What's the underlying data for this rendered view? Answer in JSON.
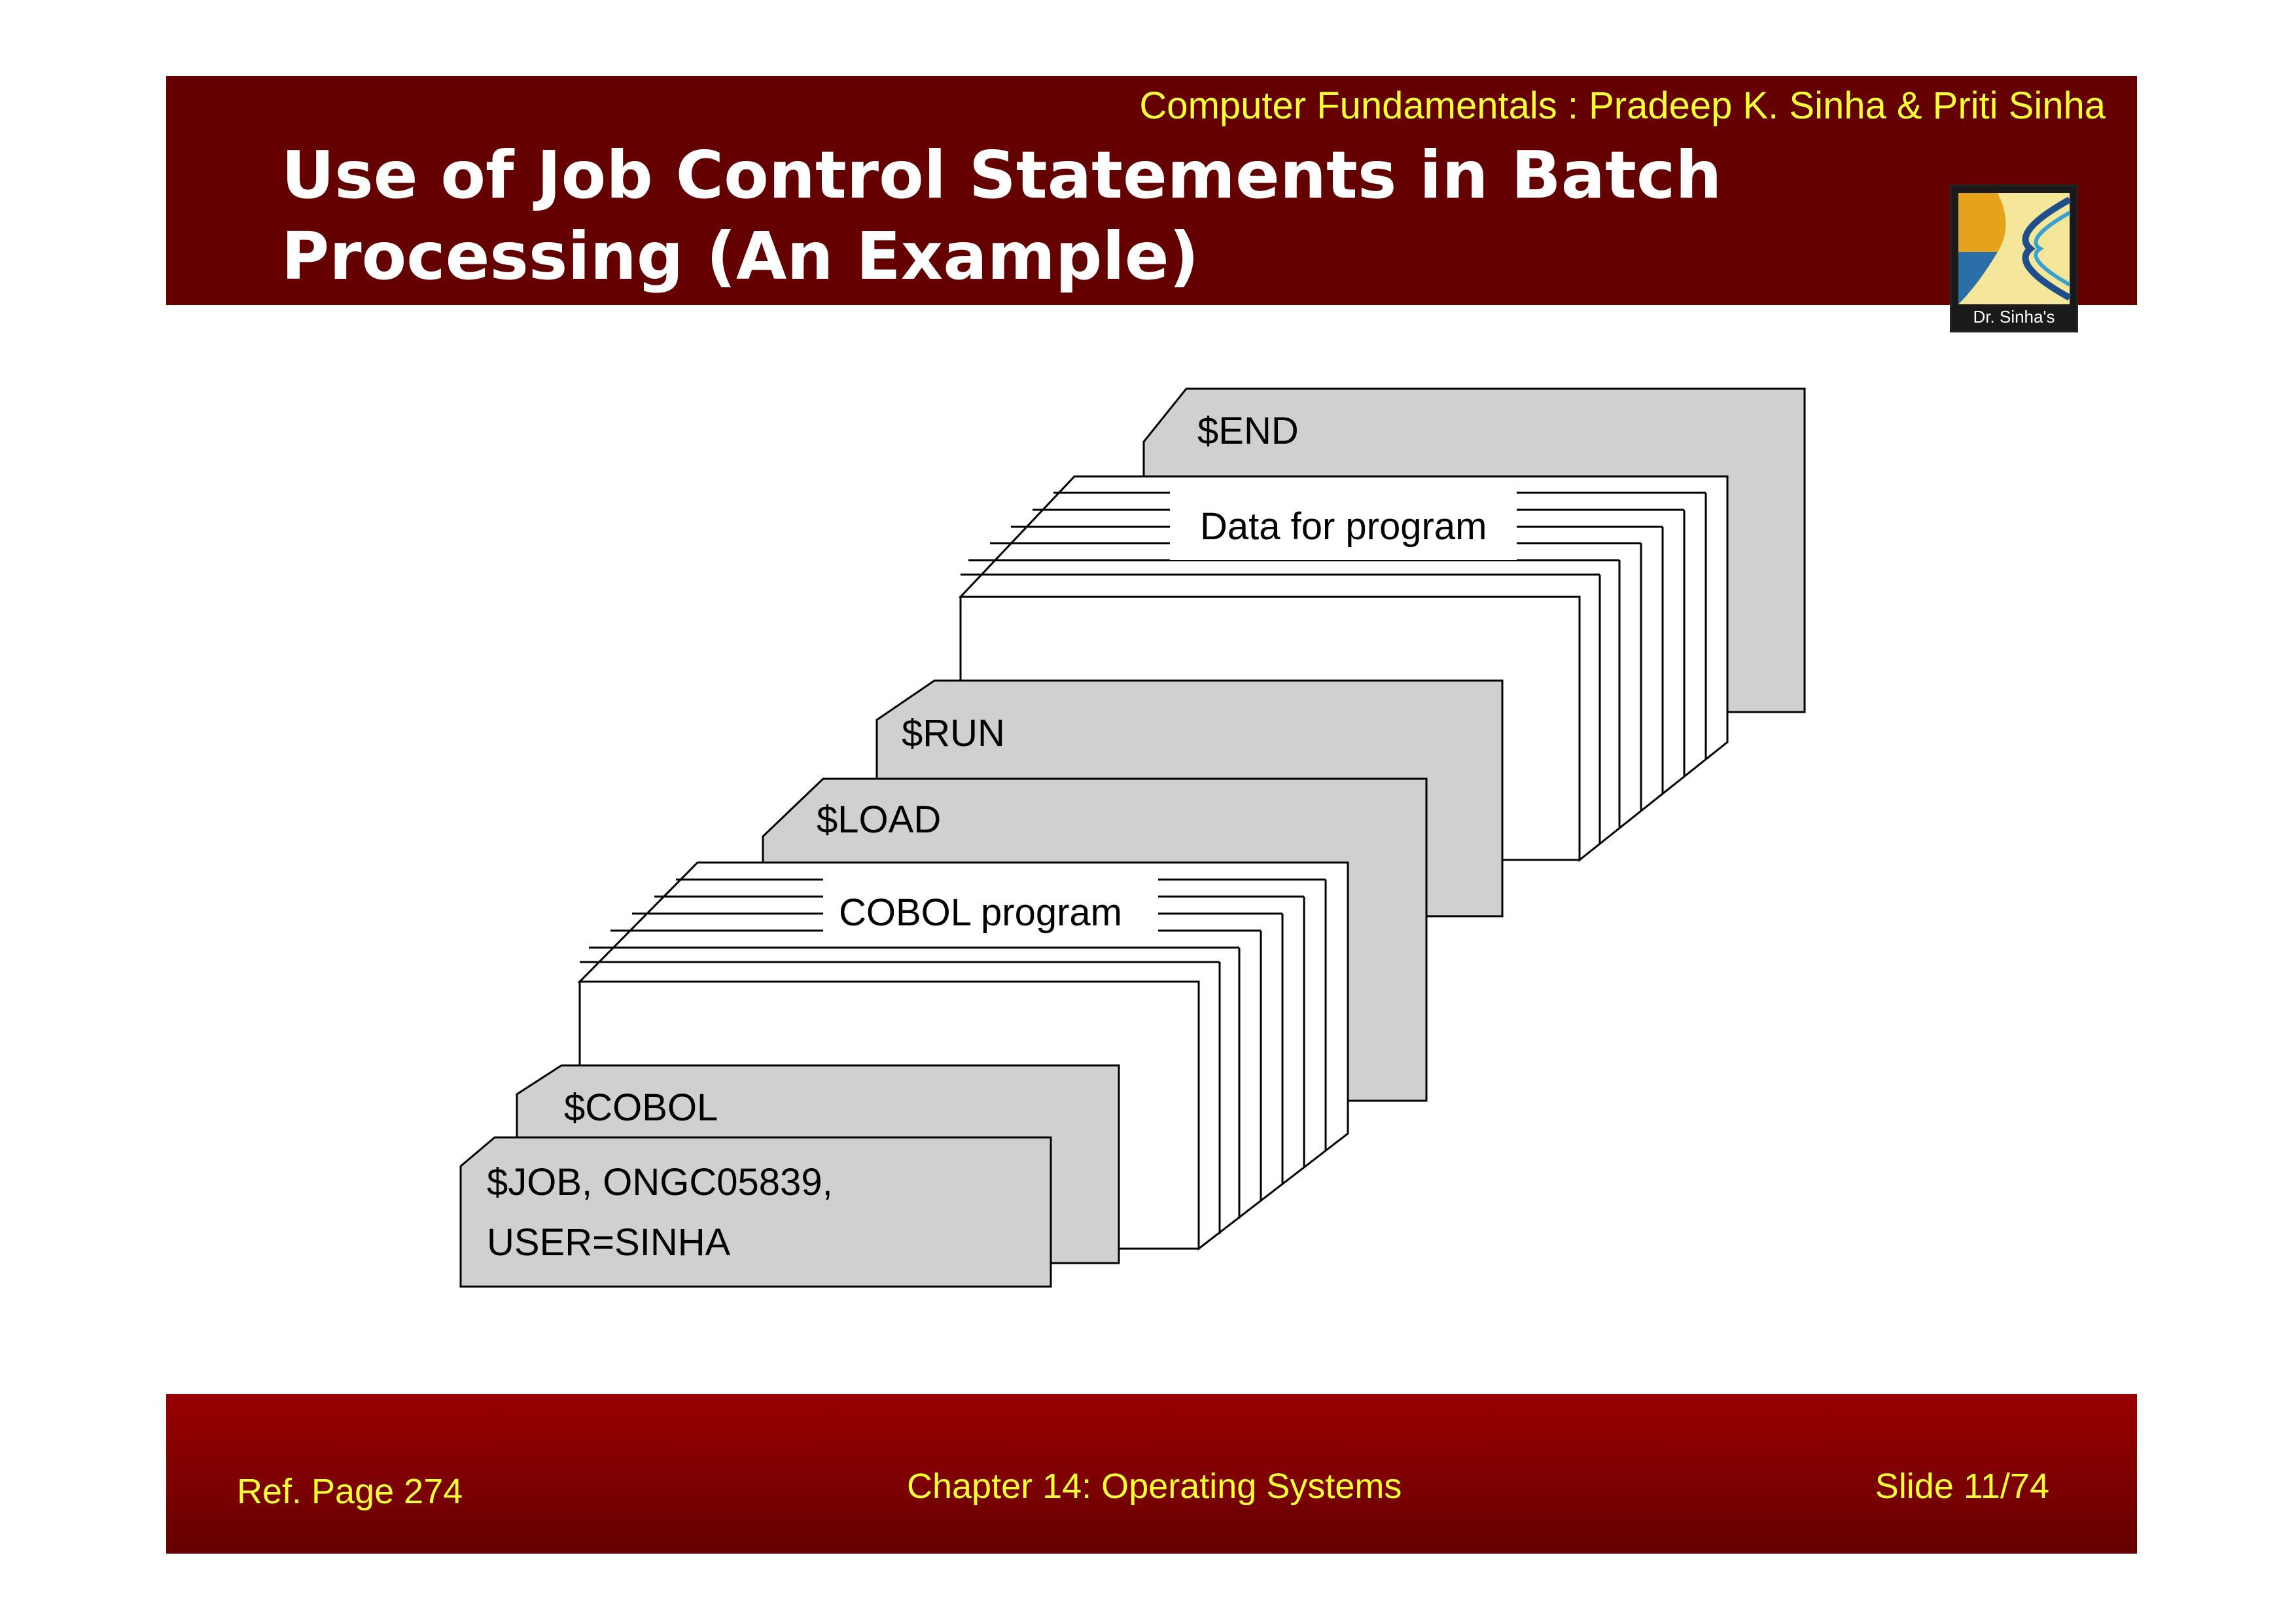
{
  "header": {
    "subtitle": "Computer Fundamentals : Pradeep K. Sinha & Priti Sinha",
    "title": "Use of Job Control Statements in Batch Processing (An Example)",
    "logo_text": "Dr. Sinha's"
  },
  "diagram": {
    "end_card": "$END",
    "data_deck_label": "Data for program",
    "run_card": "$RUN",
    "load_card": "$LOAD",
    "cobol_deck_label": "COBOL program",
    "cobol_card": "$COBOL",
    "job_card_line1": "$JOB, ONGC05839,",
    "job_card_line2": "USER=SINHA"
  },
  "footer": {
    "ref": "Ref. Page  274",
    "chapter": "Chapter 14: Operating Systems",
    "slide": "Slide 11/74"
  },
  "colors": {
    "header_bg": "#640000",
    "footer_bg": "#990000",
    "accent_text": "#ffff33",
    "card_fill": "#d0d0d0"
  }
}
